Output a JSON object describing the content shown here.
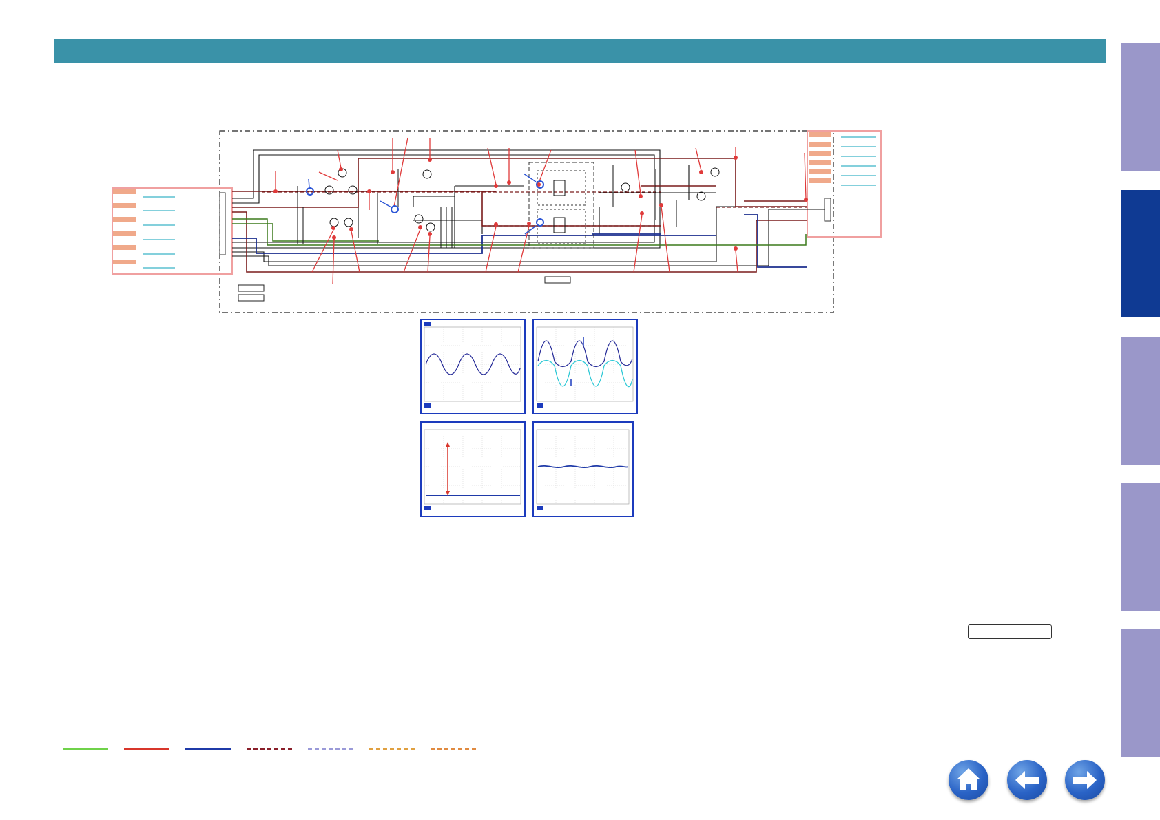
{
  "colors": {
    "header": "#3a92a8",
    "tab_inactive": "#9a97c9",
    "tab_active": "#0f3a93",
    "scope_border": "#1c3bbd",
    "wire_dark": "#111111",
    "wire_brown": "#7a1c1c",
    "wire_blue": "#1c2f8f",
    "wire_green": "#3c7a1c",
    "probe_red": "#e03a3a",
    "probe_blue": "#2d56d6",
    "connector_salmon": "#f0a98a"
  },
  "side_tabs": [
    {
      "id": "tab-1",
      "active": false
    },
    {
      "id": "tab-2",
      "active": true
    },
    {
      "id": "tab-3",
      "active": false
    },
    {
      "id": "tab-4",
      "active": false
    },
    {
      "id": "tab-5",
      "active": false
    }
  ],
  "legend": [
    {
      "style": "solid",
      "color": "#6fd24a"
    },
    {
      "style": "solid",
      "color": "#d8362b"
    },
    {
      "style": "solid",
      "color": "#1f3aa8"
    },
    {
      "style": "dashed",
      "color": "#8a1f2a"
    },
    {
      "style": "dashed",
      "color": "#9a9ad8"
    },
    {
      "style": "dashed",
      "color": "#e0a040"
    },
    {
      "style": "dashed",
      "color": "#e08a40"
    }
  ],
  "navigation": {
    "home": "home-icon",
    "back": "arrow-left-icon",
    "forward": "arrow-right-icon"
  },
  "scopes": [
    {
      "id": "scope-1",
      "waveform": "sine",
      "traces": 1,
      "color": "#2a2f9a"
    },
    {
      "id": "scope-2",
      "waveform": "sine",
      "traces": 2,
      "color": "#2a2f9a",
      "color2": "#2fc9d6"
    },
    {
      "id": "scope-3",
      "waveform": "dc",
      "traces": 1,
      "color": "#1f3aa8"
    },
    {
      "id": "scope-4",
      "waveform": "ripple",
      "traces": 1,
      "color": "#1f3aa8"
    }
  ]
}
